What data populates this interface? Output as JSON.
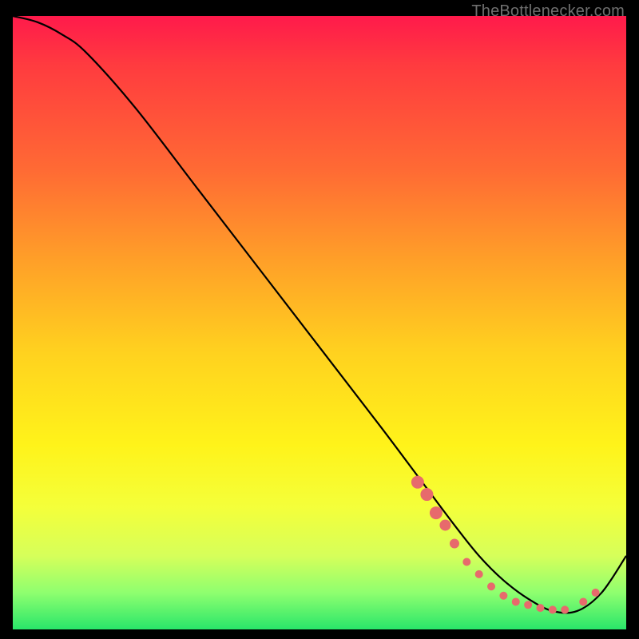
{
  "attribution": "TheBottlenecker.com",
  "chart_data": {
    "type": "line",
    "title": "",
    "xlabel": "",
    "ylabel": "",
    "xlim": [
      0,
      100
    ],
    "ylim": [
      0,
      100
    ],
    "gradient_stops": [
      {
        "pct": 0,
        "color": "#ff1a4b"
      },
      {
        "pct": 8,
        "color": "#ff3b3f"
      },
      {
        "pct": 25,
        "color": "#ff6a34"
      },
      {
        "pct": 40,
        "color": "#ffa028"
      },
      {
        "pct": 55,
        "color": "#ffd21f"
      },
      {
        "pct": 70,
        "color": "#fff31a"
      },
      {
        "pct": 80,
        "color": "#f4ff3a"
      },
      {
        "pct": 88,
        "color": "#d6ff5a"
      },
      {
        "pct": 94,
        "color": "#8fff6f"
      },
      {
        "pct": 100,
        "color": "#29e66a"
      }
    ],
    "series": [
      {
        "name": "bottleneck-curve",
        "x": [
          0,
          4,
          8,
          12,
          20,
          30,
          40,
          50,
          60,
          66,
          72,
          76,
          80,
          84,
          88,
          92,
          96,
          100
        ],
        "y": [
          100,
          99,
          97,
          94,
          85,
          72,
          59,
          46,
          33,
          25,
          17,
          12,
          8,
          5,
          3,
          3,
          6,
          12
        ]
      }
    ],
    "markers": {
      "name": "highlight-points",
      "color": "#e76a6c",
      "points": [
        {
          "x": 66,
          "y": 24,
          "r": 8
        },
        {
          "x": 67.5,
          "y": 22,
          "r": 8
        },
        {
          "x": 69,
          "y": 19,
          "r": 8
        },
        {
          "x": 70.5,
          "y": 17,
          "r": 7
        },
        {
          "x": 72,
          "y": 14,
          "r": 6
        },
        {
          "x": 74,
          "y": 11,
          "r": 5
        },
        {
          "x": 76,
          "y": 9,
          "r": 5
        },
        {
          "x": 78,
          "y": 7,
          "r": 5
        },
        {
          "x": 80,
          "y": 5.5,
          "r": 5
        },
        {
          "x": 82,
          "y": 4.5,
          "r": 5
        },
        {
          "x": 84,
          "y": 4,
          "r": 5
        },
        {
          "x": 86,
          "y": 3.5,
          "r": 5
        },
        {
          "x": 88,
          "y": 3.2,
          "r": 5
        },
        {
          "x": 90,
          "y": 3.2,
          "r": 5
        },
        {
          "x": 93,
          "y": 4.5,
          "r": 5
        },
        {
          "x": 95,
          "y": 6,
          "r": 5
        }
      ]
    }
  }
}
